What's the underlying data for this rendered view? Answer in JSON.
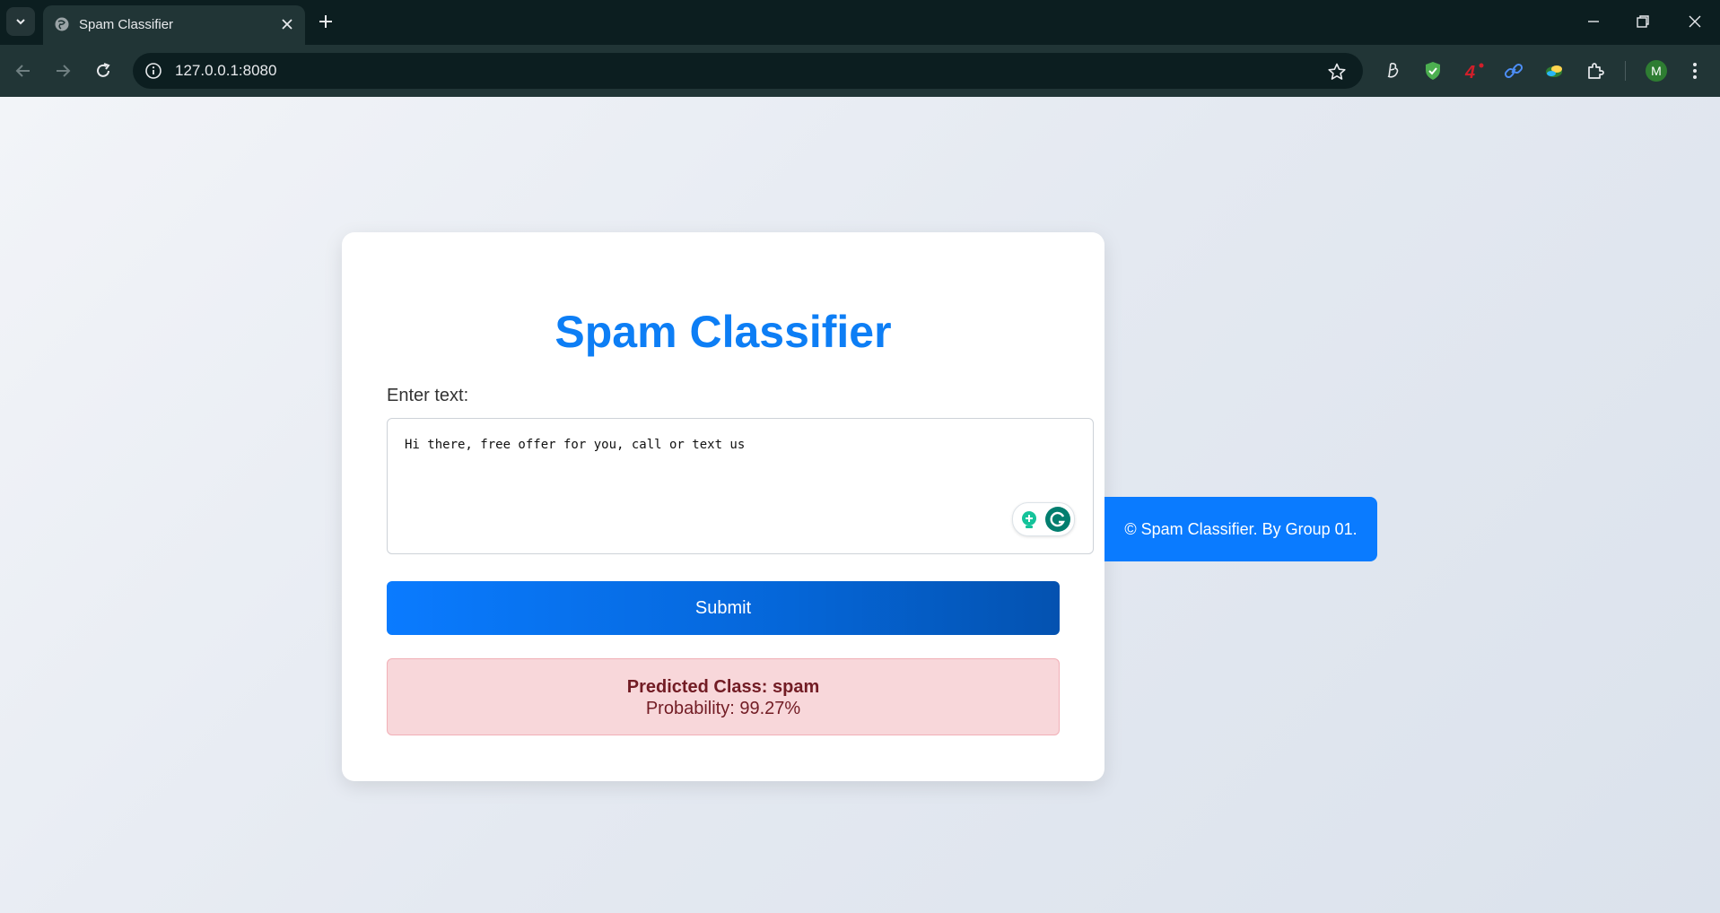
{
  "browser": {
    "tab_title": "Spam Classifier",
    "url": "127.0.0.1:8080",
    "profile_initial": "M",
    "extensions": [
      "bravo-script-icon",
      "shield-check-icon",
      "four-badge-icon",
      "link-icon",
      "colorful-bird-icon",
      "puzzle-piece-icon"
    ]
  },
  "page": {
    "heading": "Spam Classifier",
    "input_label": "Enter text:",
    "input_value": "Hi there, free offer for you, call or text us",
    "submit_label": "Submit",
    "result": {
      "class_text": "Predicted Class: spam",
      "probability_text": "Probability: 99.27%"
    },
    "footer_text": "© Spam Classifier. By Group 01."
  },
  "colors": {
    "accent": "#0d7ef5",
    "result_bg": "#f8d7da",
    "result_text": "#721c24",
    "chrome_dark": "#0c1e20",
    "chrome_toolbar": "#213536"
  }
}
